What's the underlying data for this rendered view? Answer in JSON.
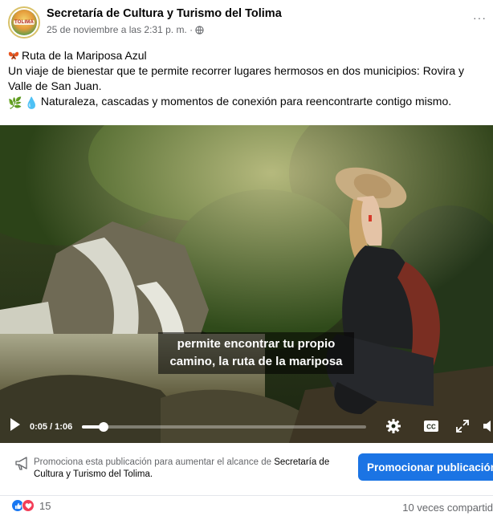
{
  "header": {
    "page_name": "Secretaría de Cultura y Turismo del Tolima",
    "timestamp": "25 de noviembre a las 2:31 p. m. ·",
    "avatar_text": "TOLIMA",
    "more_label": "···"
  },
  "post": {
    "title": "Ruta de la Mariposa Azul",
    "body": "Un viaje de bienestar que te permite recorrer lugares hermosos en dos municipios: Rovira y Valle de San Juan.",
    "tagline": "Naturaleza, cascadas y momentos de conexión para reencontrarte contigo mismo.",
    "tagline_emojis": [
      "🌿",
      "💧"
    ]
  },
  "video": {
    "subtitle_line1": "permite encontrar tu propio",
    "subtitle_line2": "camino, la ruta de la mariposa",
    "time": "0:05 / 1:06",
    "progress_fraction": 0.076,
    "cc_label": "CC"
  },
  "promo": {
    "text_prefix": "Promociona esta publicación para aumentar el alcance de ",
    "text_page": "Secretaría de Cultura y Turismo del Tolima.",
    "button_label": "Promocionar publicación"
  },
  "footer": {
    "reaction_count": "15",
    "shares": "10 veces compartid"
  },
  "colors": {
    "accent": "#1b74e4",
    "like": "#1877f2",
    "love": "#f33e58",
    "secondary_text": "#65676b"
  },
  "icons": [
    "globe-icon",
    "more-icon",
    "butterfly-icon",
    "play-icon",
    "settings-icon",
    "cc-icon",
    "fullscreen-icon",
    "volume-icon",
    "megaphone-icon",
    "like-icon",
    "love-icon"
  ]
}
